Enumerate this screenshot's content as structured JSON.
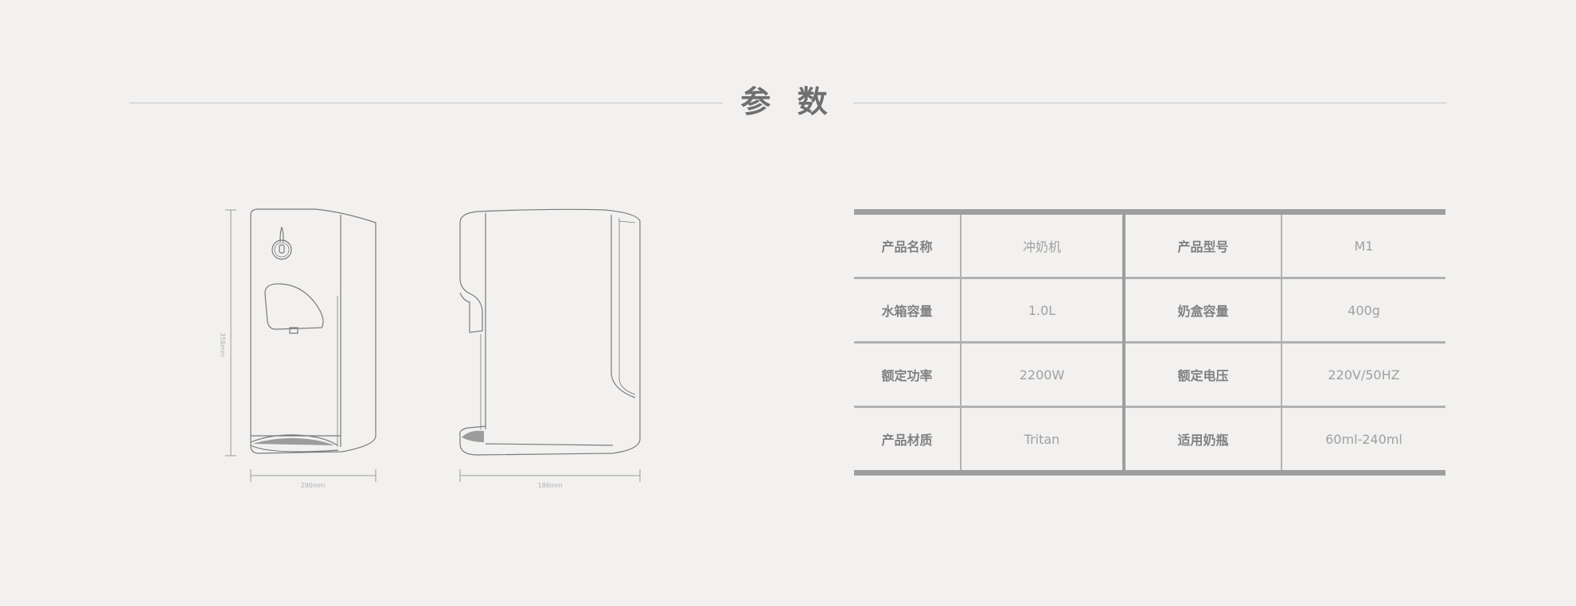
{
  "heading": "参 数",
  "dimensions": {
    "height_label": "358mm",
    "front_width_label": "290mm",
    "side_width_label": "186mm"
  },
  "specs": [
    {
      "label1": "产品名称",
      "value1": "冲奶机",
      "label2": "产品型号",
      "value2": "M1"
    },
    {
      "label1": "水箱容量",
      "value1": "1.0L",
      "label2": "奶盒容量",
      "value2": "400g"
    },
    {
      "label1": "额定功率",
      "value1": "2200W",
      "label2": "额定电压",
      "value2": "220V/50HZ"
    },
    {
      "label1": "产品材质",
      "value1": "Tritan",
      "label2": "适用奶瓶",
      "value2": "60ml-240ml"
    }
  ],
  "colors": {
    "background": "#f2f1f0",
    "heading": "#6f6f6f",
    "table_rule": "#9e9e9e",
    "label_text": "#808080",
    "value_text": "#a0a0a0",
    "line_art": "#7a7a7a"
  }
}
